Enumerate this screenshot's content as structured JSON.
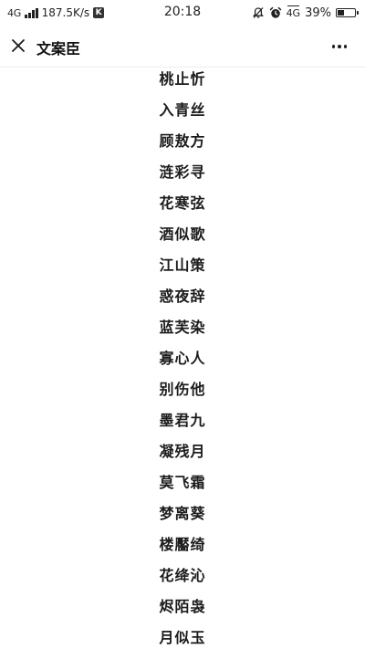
{
  "status_bar": {
    "network": "4G",
    "speed": "187.5K/s",
    "app_badge": "K",
    "time": "20:18",
    "network_right": "4G",
    "battery_text": "39%",
    "battery_level": 0.39,
    "icons": [
      "signal-icon",
      "k-app-icon",
      "mute-bell-icon",
      "alarm-icon",
      "battery-icon"
    ]
  },
  "nav": {
    "title": "文案臣",
    "close_icon": "close-icon",
    "more_icon": "more-icon"
  },
  "names": [
    "桃止忻",
    "入青丝",
    "顾敖方",
    "涟彩寻",
    "花寒弦",
    "酒似歌",
    "江山策",
    "惑夜辞",
    "蓝芙染",
    "寡心人",
    "别伤他",
    "墨君九",
    "凝残月",
    "莫飞霜",
    "梦离葵",
    "楼靨绮",
    "花绛沁",
    "烬陌袅",
    "月似玉"
  ]
}
